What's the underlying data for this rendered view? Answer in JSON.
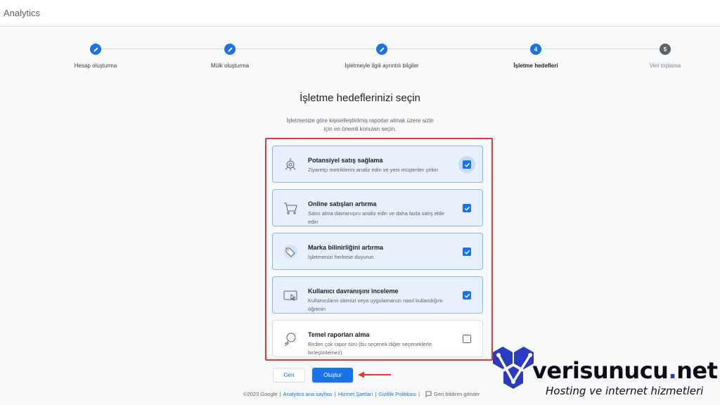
{
  "header": {
    "app_title": "Analytics"
  },
  "stepper": {
    "steps": [
      {
        "label": "Hesap oluşturma",
        "state": "done",
        "number": ""
      },
      {
        "label": "Mülk oluşturma",
        "state": "done",
        "number": ""
      },
      {
        "label": "İşletmeyle ilgili ayrıntılı bilgiler",
        "state": "done",
        "number": ""
      },
      {
        "label": "İşletme hedefleri",
        "state": "current",
        "number": "4"
      },
      {
        "label": "Veri toplama",
        "state": "pending",
        "number": "5"
      }
    ]
  },
  "main": {
    "title": "İşletme hedeflerinizi seçin",
    "subtitle": "İşletmenize göre kişiselleştirilmiş raporlar almak üzere sizin için en önemli konuları seçin.",
    "options": [
      {
        "title": "Potansiyel satış sağlama",
        "description": "Ziyaretçi metriklerini analiz edin ve yeni müşteriler çekin",
        "checked": true,
        "icon": "target-icon"
      },
      {
        "title": "Online satışları artırma",
        "description": "Satın alma davranışını analiz edin ve daha fazla satış elde edin",
        "checked": true,
        "icon": "shopping-cart-icon"
      },
      {
        "title": "Marka bilinirliğini artırma",
        "description": "İşletmenizi herkese duyurun",
        "checked": true,
        "icon": "tag-icon"
      },
      {
        "title": "Kullanıcı davranışını inceleme",
        "description": "Kullanıcıların sitenizi veya uygulamanızı nasıl kullandığını öğrenin",
        "checked": true,
        "icon": "screen-cursor-icon"
      },
      {
        "title": "Temel raporları alma",
        "description": "Birden çok rapor türü (bu seçenek diğer seçeneklerle birleştirilemez)",
        "checked": false,
        "icon": "report-search-icon"
      }
    ]
  },
  "actions": {
    "back_label": "Geri",
    "create_label": "Oluştur"
  },
  "footer": {
    "copyright": "©2023 Google",
    "links": [
      "Analytics ana sayfası",
      "Hizmet Şartları",
      "Gizlilik Politikası"
    ],
    "feedback": "Geri bildirim gönder"
  },
  "watermark": {
    "brand_name": "verisunucu",
    "brand_tld": "net",
    "tagline": "Hosting ve internet hizmetleri"
  },
  "colors": {
    "primary": "#1a73e8",
    "selected_bg": "#e8f0fe",
    "highlight_border": "#e53935",
    "watermark_blue": "#2a3bbf"
  }
}
